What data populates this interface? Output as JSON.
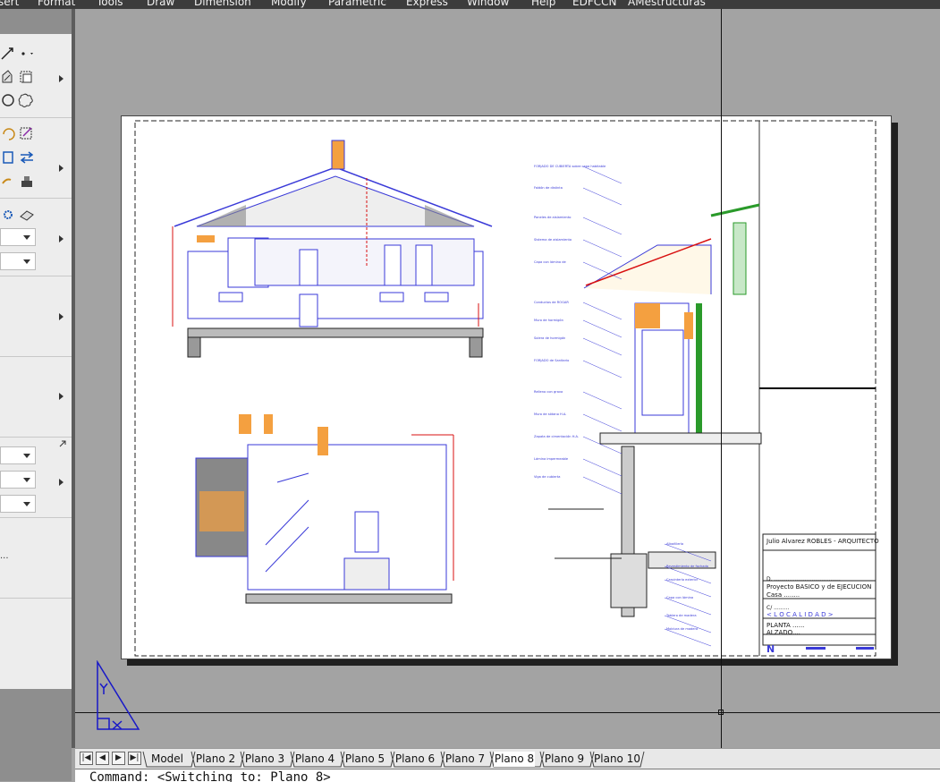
{
  "menu": [
    "sert",
    "Format",
    "Tools",
    "Draw",
    "Dimension",
    "Modify",
    "Parametric",
    "Express",
    "Window",
    "Help",
    "EDFCCN",
    "AMestructuras"
  ],
  "palette": {
    "dots_label": "..."
  },
  "drawing": {
    "elevation_labels": [
      "Model"
    ],
    "annotations": [
      "FORJADO DE CUBIERTA sobre capa habitable",
      "Faldón de distinta",
      "Paneles de aislamiento",
      "Sistema de aislamiento",
      "Capa con lámina de",
      "Conductos de ROGAR",
      "Muro de hormigón",
      "Solera de hormigón",
      "FORJADO de Sanitario",
      "Relleno con grava",
      "Muro de sótano H.A.",
      "Zapata de cimentación H.A.",
      "Lámina impermeable",
      "Viga de cubierta",
      "Albañilería",
      "Revestimiento de fachada",
      "Carpintería exterior",
      "Capa con lámina",
      "Tablero de madera",
      "Moldura de madera"
    ]
  },
  "title_block": {
    "author": "Julio Alvarez ROBLES  -  ARQUITECTO",
    "client_line": "D. .......................................",
    "project_line": "Proyecto BASICO y de EJECUCION",
    "house_line": "Casa ........",
    "address_line": "C/ .........",
    "locality_line": "< L O C A L I D A D >",
    "sheet_line_1": "PLANTA ......",
    "sheet_line_2": "ALZADO....",
    "north_mark": "N"
  },
  "tabs": {
    "nav": [
      "|◀",
      "◀",
      "▶",
      "▶|"
    ],
    "items": [
      {
        "label": "Model",
        "active": false
      },
      {
        "label": "Plano 2",
        "active": false
      },
      {
        "label": "Plano 3",
        "active": false
      },
      {
        "label": "Plano 4",
        "active": false
      },
      {
        "label": "Plano 5",
        "active": false
      },
      {
        "label": "Plano 6",
        "active": false
      },
      {
        "label": "Plano 7",
        "active": false
      },
      {
        "label": "Plano 8",
        "active": true
      },
      {
        "label": "Plano 9",
        "active": false
      },
      {
        "label": "Plano 10",
        "active": false
      }
    ]
  },
  "command": {
    "text": "Command:  <Switching to: Plano 8>"
  },
  "colors": {
    "drawing_blue": "#3a3ad8",
    "dimension_red": "#d81010",
    "fill_orange": "#f4a040",
    "green": "#2a9a2a",
    "background": "#a3a3a3",
    "paper": "#ffffff"
  }
}
